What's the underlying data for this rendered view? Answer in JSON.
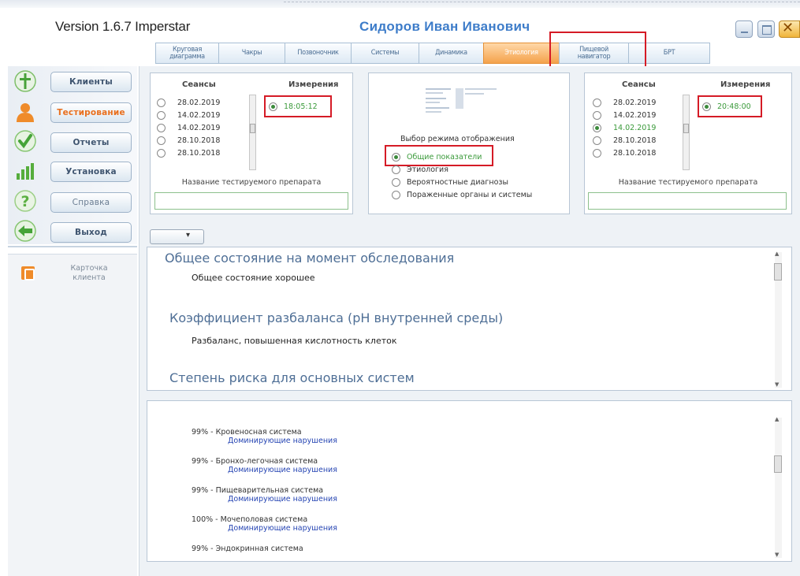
{
  "app": {
    "version": "Version 1.6.7 Imperstar",
    "user_name": "Сидоров Иван Иванович"
  },
  "colors": {
    "accent": "#3d7cc9",
    "active_tab": "#f4a24c",
    "highlight": "#d51b26",
    "selected_time": "#3a9a3a"
  },
  "tabs": [
    {
      "label": "Круговая\nдиаграмма"
    },
    {
      "label": "Чакры"
    },
    {
      "label": "Позвоночник"
    },
    {
      "label": "Системы"
    },
    {
      "label": "Динамика"
    },
    {
      "label": "Этиология",
      "active": true
    },
    {
      "label": "Пищевой\nнавигатор"
    },
    {
      "label": "БРТ"
    }
  ],
  "nav": [
    {
      "label": "Клиенты",
      "icon": "person-icon"
    },
    {
      "label": "Тестирование",
      "icon": "user-orange-icon"
    },
    {
      "label": "Отчеты",
      "icon": "checkmark-icon"
    },
    {
      "label": "Установка",
      "icon": "bars-icon"
    },
    {
      "label": "Справка",
      "icon": "question-icon"
    },
    {
      "label": "Выход",
      "icon": "exit-arrow-icon"
    }
  ],
  "card": {
    "label": "Карточка\nклиента"
  },
  "left_session": {
    "sessions_header": "Сеансы",
    "measure_header": "Измерения",
    "sessions": [
      "28.02.2019",
      "14.02.2019",
      "14.02.2019",
      "28.10.2018",
      "28.10.2018"
    ],
    "measurement": "18:05:12",
    "drug_label": "Название тестируемого препарата"
  },
  "right_session": {
    "sessions_header": "Сеансы",
    "measure_header": "Измерения",
    "sessions": [
      "28.02.2019",
      "14.02.2019",
      "14.02.2019",
      "28.10.2018",
      "28.10.2018"
    ],
    "measurement": "20:48:00",
    "drug_label": "Название тестируемого препарата"
  },
  "display_mode": {
    "title": "Выбор режима отображения",
    "options": [
      "Общие показатели",
      "Этиология",
      "Вероятностные диагнозы",
      "Пораженные органы и системы"
    ]
  },
  "report": {
    "h1": "Общее состояние на момент обследования",
    "p1": "Общее состояние хорошее",
    "h2": "Коэффициент разбаланса (pH внутренней среды)",
    "p2": "Разбаланс, повышенная кислотность клеток",
    "h3": "Степень риска для основных систем"
  },
  "risks": [
    {
      "label": "99% - Кровеносная система",
      "sub": "Доминирующие нарушения"
    },
    {
      "label": "99% - Бронхо-легочная система",
      "sub": "Доминирующие нарушения"
    },
    {
      "label": "99% - Пищеварительная система",
      "sub": "Доминирующие нарушения"
    },
    {
      "label": "100% - Мочеполовая система",
      "sub": "Доминирующие нарушения"
    },
    {
      "label": "99% - Эндокринная система",
      "sub": ""
    }
  ]
}
